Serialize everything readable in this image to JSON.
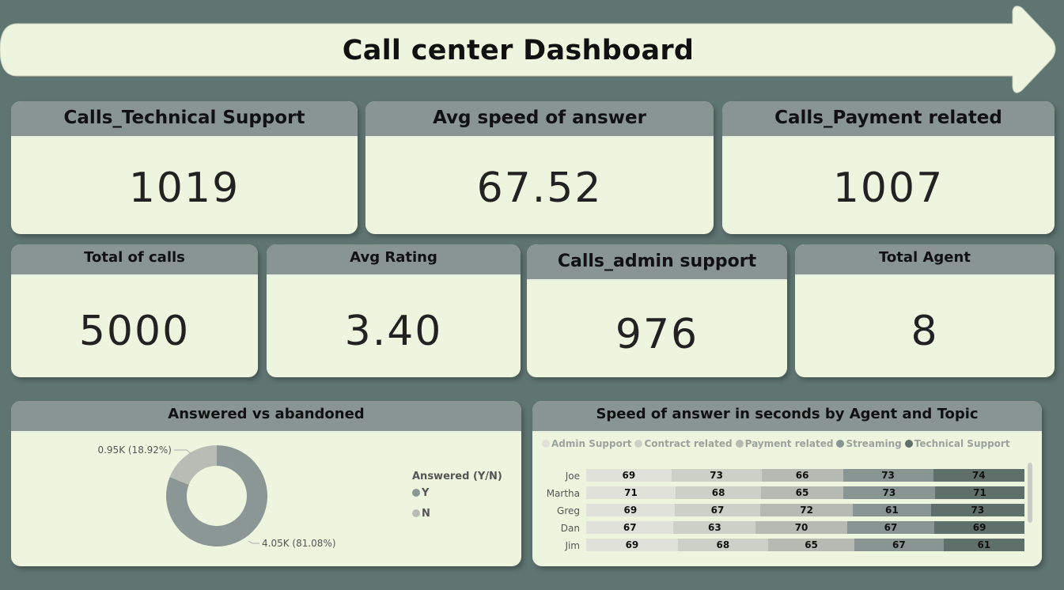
{
  "header": {
    "title": "Call center Dashboard"
  },
  "kpis": {
    "technical_support": {
      "label": "Calls_Technical Support",
      "value": "1019"
    },
    "avg_speed": {
      "label": "Avg speed of answer",
      "value": "67.52"
    },
    "payment_related": {
      "label": "Calls_Payment related",
      "value": "1007"
    },
    "total_calls": {
      "label": "Total of calls",
      "value": "5000"
    },
    "avg_rating": {
      "label": "Avg Rating",
      "value": "3.40"
    },
    "admin_support": {
      "label": "Calls_admin support",
      "value": "976"
    },
    "total_agent": {
      "label": "Total Agent",
      "value": "8"
    }
  },
  "donut": {
    "title": "Answered vs abandoned",
    "legend_title": "Answered (Y/N)",
    "label_n": "0.95K (18.92%)",
    "label_y": "4.05K (81.08%)",
    "legend": [
      "Y",
      "N"
    ],
    "colors": {
      "Y": "#8a9794",
      "N": "#b7bdb4"
    }
  },
  "bars": {
    "title": "Speed of answer in seconds by Agent and Topic",
    "legend": [
      "Admin Support",
      "Contract related",
      "Payment related",
      "Streaming",
      "Technical Support"
    ],
    "colors": [
      "#e0e2da",
      "#cdd0c6",
      "#b5bab2",
      "#889593",
      "#5f706b"
    ]
  },
  "chart_data": [
    {
      "type": "pie",
      "title": "Answered vs abandoned",
      "categories": [
        "Y",
        "N"
      ],
      "values": [
        4054,
        946
      ],
      "labels": [
        "4.05K (81.08%)",
        "0.95K (18.92%)"
      ]
    },
    {
      "type": "bar",
      "title": "Speed of answer in seconds by Agent and Topic",
      "categories": [
        "Joe",
        "Martha",
        "Greg",
        "Dan",
        "Jim"
      ],
      "series": [
        {
          "name": "Admin Support",
          "values": [
            69,
            71,
            69,
            67,
            69
          ]
        },
        {
          "name": "Contract related",
          "values": [
            73,
            68,
            67,
            63,
            68
          ]
        },
        {
          "name": "Payment related",
          "values": [
            66,
            65,
            72,
            70,
            65
          ]
        },
        {
          "name": "Streaming",
          "values": [
            73,
            73,
            61,
            67,
            67
          ]
        },
        {
          "name": "Technical Support",
          "values": [
            74,
            71,
            73,
            69,
            61
          ]
        }
      ]
    }
  ]
}
